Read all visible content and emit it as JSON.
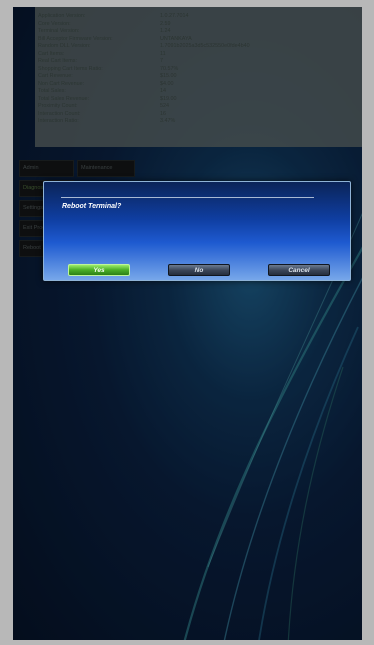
{
  "info_panel": {
    "rows": [
      {
        "label": "Application Version:",
        "value": "1.0.27.7014"
      },
      {
        "label": "Core Version:",
        "value": "2.59"
      },
      {
        "label": "Terminal Version:",
        "value": "1.24"
      },
      {
        "label": "Bill Acceptor Firmware Version:",
        "value": "UNTANKAYA"
      },
      {
        "label": "Random DLL Version:",
        "value": "1.7091b2025a3d5c532550e0fde4b40"
      },
      {
        "label": "Cart Items:",
        "value": "11"
      },
      {
        "label": "Real Cart Items:",
        "value": "7"
      },
      {
        "label": "Shopping Cart Items Ratio:",
        "value": "70.57%"
      },
      {
        "label": "Cart Revenue:",
        "value": "$15.00"
      },
      {
        "label": "Non Cart Revenue:",
        "value": "$4.00"
      },
      {
        "label": "Total Sales:",
        "value": "14"
      },
      {
        "label": "Total Sales Revenue:",
        "value": "$19.00"
      },
      {
        "label": "Proximity Count:",
        "value": "524"
      },
      {
        "label": "Interaction Count:",
        "value": "16"
      },
      {
        "label": "Interaction Ratio:",
        "value": "3.47%"
      }
    ]
  },
  "menu_buttons": [
    {
      "label": "Admin"
    },
    {
      "label": "Maintenance"
    },
    {
      "label": "Diagnostics"
    },
    {
      "label": "Settings"
    },
    {
      "label": "Exit Program"
    },
    {
      "label": "Reboot"
    }
  ],
  "dialog": {
    "message": "Reboot Terminal?",
    "yes_label": "Yes",
    "no_label": "No",
    "cancel_label": "Cancel"
  },
  "colors": {
    "background": "#0a2040",
    "dialog_top": "#0b2458",
    "dialog_bottom": "#77a7ea",
    "yes_button": "#4bb028",
    "neutral_button": "#3b4659"
  }
}
